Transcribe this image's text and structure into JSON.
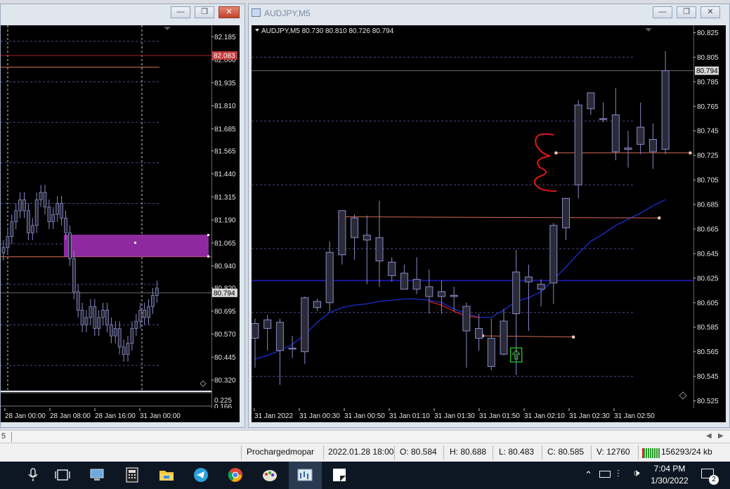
{
  "left_window": {
    "price_labels": [
      "82.185",
      "82.060",
      "81.935",
      "81.810",
      "81.685",
      "81.565",
      "81.440",
      "81.315",
      "81.190",
      "81.065",
      "80.940",
      "80.820",
      "80.695",
      "80.570",
      "80.445",
      "80.320"
    ],
    "red_line_label": "82.083",
    "current_price_label": "80.794",
    "indicator_labels": [
      "0.225",
      "0.166"
    ],
    "time_labels": [
      "28 Jan 00:00",
      "28 Jan 08:00",
      "28 Jan 16:00",
      "31 Jan 00:00"
    ],
    "closes": [
      81.04,
      81.1,
      81.18,
      81.24,
      81.3,
      81.24,
      81.12,
      81.16,
      81.3,
      81.34,
      81.26,
      81.18,
      81.22,
      81.28,
      81.2,
      81.12,
      80.98,
      80.8,
      80.7,
      80.62,
      80.66,
      80.72,
      80.6,
      80.66,
      80.7,
      80.62,
      80.56,
      80.6,
      80.5,
      80.46,
      80.52,
      80.6,
      80.64,
      80.7,
      80.66,
      80.72,
      80.78,
      80.82
    ]
  },
  "right_window": {
    "title": "AUDJPY,M5",
    "ohlc_header": "AUDJPY,M5  80.730 80.810 80.726 80.794",
    "price_labels": [
      "80.825",
      "80.805",
      "80.785",
      "80.765",
      "80.745",
      "80.725",
      "80.705",
      "80.685",
      "80.665",
      "80.645",
      "80.625",
      "80.605",
      "80.585",
      "80.565",
      "80.545",
      "80.525"
    ],
    "current_price_label": "80.794",
    "time_labels": [
      "31 Jan 2022",
      "31 Jan 00:30",
      "31 Jan 00:50",
      "31 Jan 01:10",
      "31 Jan 01:30",
      "31 Jan 01:50",
      "31 Jan 02:10",
      "31 Jan 02:30",
      "31 Jan 02:50"
    ]
  },
  "chart_data": {
    "type": "candlestick",
    "symbol": "AUDJPY",
    "timeframe": "M5",
    "ylim": [
      80.519,
      80.831
    ],
    "candles": [
      {
        "o": 80.576,
        "h": 80.592,
        "l": 80.552,
        "c": 80.588
      },
      {
        "o": 80.584,
        "h": 80.595,
        "l": 80.566,
        "c": 80.591
      },
      {
        "o": 80.589,
        "h": 80.592,
        "l": 80.538,
        "c": 80.566
      },
      {
        "o": 80.568,
        "h": 80.578,
        "l": 80.56,
        "c": 80.568
      },
      {
        "o": 80.565,
        "h": 80.61,
        "l": 80.555,
        "c": 80.609
      },
      {
        "o": 80.601,
        "h": 80.608,
        "l": 80.598,
        "c": 80.606
      },
      {
        "o": 80.605,
        "h": 80.655,
        "l": 80.598,
        "c": 80.646
      },
      {
        "o": 80.644,
        "h": 80.68,
        "l": 80.636,
        "c": 80.68
      },
      {
        "o": 80.674,
        "h": 80.677,
        "l": 80.64,
        "c": 80.658
      },
      {
        "o": 80.66,
        "h": 80.676,
        "l": 80.62,
        "c": 80.656
      },
      {
        "o": 80.658,
        "h": 80.688,
        "l": 80.618,
        "c": 80.639
      },
      {
        "o": 80.638,
        "h": 80.642,
        "l": 80.622,
        "c": 80.627
      },
      {
        "o": 80.629,
        "h": 80.636,
        "l": 80.618,
        "c": 80.616
      },
      {
        "o": 80.624,
        "h": 80.642,
        "l": 80.612,
        "c": 80.616
      },
      {
        "o": 80.618,
        "h": 80.632,
        "l": 80.596,
        "c": 80.61
      },
      {
        "o": 80.614,
        "h": 80.623,
        "l": 80.596,
        "c": 80.61
      },
      {
        "o": 80.611,
        "h": 80.618,
        "l": 80.598,
        "c": 80.61
      },
      {
        "o": 80.602,
        "h": 80.605,
        "l": 80.552,
        "c": 80.582
      },
      {
        "o": 80.584,
        "h": 80.596,
        "l": 80.566,
        "c": 80.576
      },
      {
        "o": 80.576,
        "h": 80.592,
        "l": 80.55,
        "c": 80.553
      },
      {
        "o": 80.563,
        "h": 80.6,
        "l": 80.562,
        "c": 80.59
      },
      {
        "o": 80.596,
        "h": 80.648,
        "l": 80.546,
        "c": 80.63
      },
      {
        "o": 80.626,
        "h": 80.636,
        "l": 80.582,
        "c": 80.622
      },
      {
        "o": 80.62,
        "h": 80.624,
        "l": 80.602,
        "c": 80.616
      },
      {
        "o": 80.621,
        "h": 80.67,
        "l": 80.604,
        "c": 80.668
      },
      {
        "o": 80.666,
        "h": 80.69,
        "l": 80.656,
        "c": 80.69
      },
      {
        "o": 80.701,
        "h": 80.77,
        "l": 80.69,
        "c": 80.766
      },
      {
        "o": 80.763,
        "h": 80.776,
        "l": 80.758,
        "c": 80.776
      },
      {
        "o": 80.755,
        "h": 80.768,
        "l": 80.752,
        "c": 80.755
      },
      {
        "o": 80.758,
        "h": 80.78,
        "l": 80.721,
        "c": 80.728
      },
      {
        "o": 80.73,
        "h": 80.745,
        "l": 80.715,
        "c": 80.731
      },
      {
        "o": 80.748,
        "h": 80.768,
        "l": 80.726,
        "c": 80.734
      },
      {
        "o": 80.738,
        "h": 80.751,
        "l": 80.714,
        "c": 80.728
      },
      {
        "o": 80.73,
        "h": 80.81,
        "l": 80.726,
        "c": 80.794
      }
    ],
    "current_price": 80.794,
    "horizontal_lines": [
      {
        "price": 80.794,
        "color": "#6e6e6e"
      },
      {
        "price": 80.623,
        "color": "#1a1aa8"
      }
    ],
    "trendlines": [
      {
        "x1": 6.8,
        "y1": 80.675,
        "x2": 32.5,
        "y2": 80.674,
        "color": "#d46a50"
      },
      {
        "x1": 18.3,
        "y1": 80.578,
        "x2": 25.6,
        "y2": 80.577,
        "color": "#d46a50"
      },
      {
        "x1": 24.2,
        "y1": 80.727,
        "x2": 35.0,
        "y2": 80.727,
        "color": "#d46a50"
      }
    ],
    "moving_average": [
      80.559,
      80.562,
      80.566,
      80.571,
      80.579,
      80.589,
      80.597,
      80.601,
      80.603,
      80.604,
      80.606,
      80.607,
      80.608,
      80.608,
      80.607,
      80.605,
      80.6,
      80.596,
      80.593,
      80.593,
      80.599,
      80.606,
      80.609,
      80.614,
      80.624,
      80.634,
      80.645,
      80.655,
      80.661,
      80.668,
      80.673,
      80.678,
      80.684,
      80.689
    ],
    "red_fragment": [
      80.606,
      80.603,
      80.598,
      80.594,
      80.593
    ],
    "buy_arrow": {
      "index": 21,
      "price": 80.563
    }
  },
  "status_bar": {
    "profile": "Prochargedmopar",
    "datetime": "2022.01.28 18:00",
    "open": "O: 80.584",
    "high": "H: 80.688",
    "low": "L: 80.483",
    "close": "C: 80.585",
    "volume": "V: 12760",
    "traffic": "156293/24 kb",
    "tab_fragment": "5"
  },
  "taskbar": {
    "time": "7:04 PM",
    "date": "1/30/2022",
    "notifications": "2",
    "apps": [
      "microphone-icon",
      "task-view-icon",
      "computer-icon",
      "calculator-icon",
      "file-explorer-icon",
      "telegram-icon",
      "chrome-icon",
      "paint-icon",
      "metatrader-icon",
      "notes-icon"
    ]
  },
  "colors": {
    "chart_bg": "#000000",
    "candle_body": "#2a2a38",
    "candle_border": "#8a8ac8",
    "grid": "#4a4a8a",
    "ma": "#1c2ed0",
    "highlight_rect": "#8e2aa0",
    "current_price_tag": "#d8d8d8"
  }
}
